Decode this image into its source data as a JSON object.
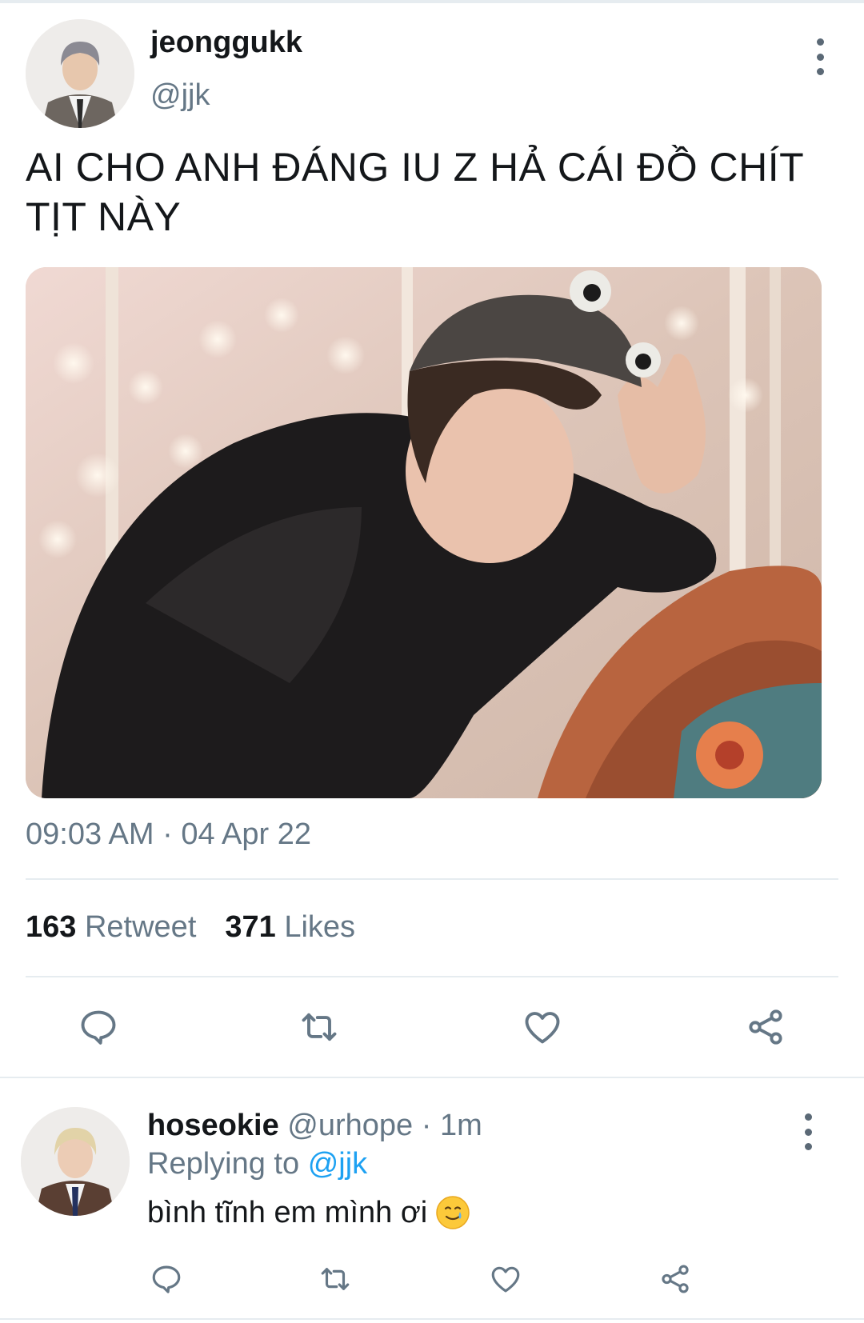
{
  "tweet": {
    "author_name": "jeonggukk",
    "author_handle": "@jjk",
    "text": "AI CHO ANH ĐÁNG IU Z HẢ CÁI ĐỒ CHÍT TỊT NÀY",
    "timestamp": "09:03 AM · 04 Apr 22",
    "retweet_count": "163",
    "retweet_label": "Retweet",
    "like_count": "371",
    "like_label": "Likes"
  },
  "reply": {
    "author_name": "hoseokie",
    "author_handle": "@urhope",
    "separator": "·",
    "time": "1m",
    "replying_prefix": "Replying to",
    "replying_to": "@jjk",
    "text": "bình tĩnh em mình ơi"
  },
  "icons": {
    "more": "more-vertical-icon",
    "reply": "reply-icon",
    "retweet": "retweet-icon",
    "like": "heart-icon",
    "share": "share-icon",
    "emoji": "smiling-face-with-tear-emoji"
  },
  "colors": {
    "text_primary": "#14171a",
    "text_secondary": "#657786",
    "icon": "#657786",
    "link": "#1da1f2",
    "divider": "#e6ecf0"
  }
}
